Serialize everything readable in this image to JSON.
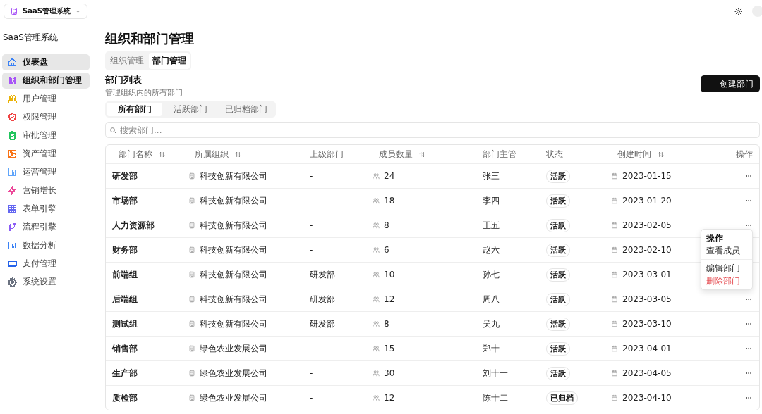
{
  "app_switcher": {
    "label": "SaaS管理系统"
  },
  "sidebar": {
    "title": "SaaS管理系统",
    "items": [
      {
        "label": "仪表盘",
        "selected": true,
        "color": "#3b82f6"
      },
      {
        "label": "组织和部门管理",
        "selected": true,
        "color": "#a855f7"
      },
      {
        "label": "用户管理",
        "selected": false,
        "color": "#eab308"
      },
      {
        "label": "权限管理",
        "selected": false,
        "color": "#ef4444"
      },
      {
        "label": "审批管理",
        "selected": false,
        "color": "#22c55e"
      },
      {
        "label": "资产管理",
        "selected": false,
        "color": "#f97316"
      },
      {
        "label": "运营管理",
        "selected": false,
        "color": "#60a5fa"
      },
      {
        "label": "营销增长",
        "selected": false,
        "color": "#ec4899"
      },
      {
        "label": "表单引擎",
        "selected": false,
        "color": "#6366f1"
      },
      {
        "label": "流程引擎",
        "selected": false,
        "color": "#8b5cf6"
      },
      {
        "label": "数据分析",
        "selected": false,
        "color": "#3b82f6"
      },
      {
        "label": "支付管理",
        "selected": false,
        "color": "#2563eb"
      },
      {
        "label": "系统设置",
        "selected": false,
        "color": "#6b7280"
      }
    ]
  },
  "page": {
    "title": "组织和部门管理",
    "tabs": [
      {
        "label": "组织管理",
        "selected": false
      },
      {
        "label": "部门管理",
        "selected": true
      }
    ]
  },
  "section": {
    "title": "部门列表",
    "subtitle": "管理组织内的所有部门",
    "create_button": "创建部门"
  },
  "filters": [
    {
      "label": "所有部门",
      "selected": true
    },
    {
      "label": "活跃部门",
      "selected": false
    },
    {
      "label": "已归档部门",
      "selected": false
    }
  ],
  "search": {
    "placeholder": "搜索部门..."
  },
  "table": {
    "columns": [
      {
        "label": "部门名称",
        "sortable": true
      },
      {
        "label": "所属组织",
        "sortable": true
      },
      {
        "label": "上级部门",
        "sortable": false
      },
      {
        "label": "成员数量",
        "sortable": true
      },
      {
        "label": "部门主管",
        "sortable": false
      },
      {
        "label": "状态",
        "sortable": false
      },
      {
        "label": "创建时间",
        "sortable": true
      },
      {
        "label": "操作",
        "sortable": false
      }
    ],
    "rows": [
      {
        "name": "研发部",
        "org": "科技创新有限公司",
        "parent": "-",
        "members": "24",
        "manager": "张三",
        "status": "活跃",
        "created": "2023-01-15",
        "menu_button": true
      },
      {
        "name": "市场部",
        "org": "科技创新有限公司",
        "parent": "-",
        "members": "18",
        "manager": "李四",
        "status": "活跃",
        "created": "2023-01-20",
        "menu_button": true
      },
      {
        "name": "人力资源部",
        "org": "科技创新有限公司",
        "parent": "-",
        "members": "8",
        "manager": "王五",
        "status": "活跃",
        "created": "2023-02-05",
        "menu_button": true,
        "menu": {
          "title": "操作",
          "items": [
            {
              "kind": "item",
              "label": "查看成员"
            },
            {
              "kind": "separator"
            },
            {
              "kind": "item",
              "label": "编辑部门"
            },
            {
              "kind": "danger",
              "label": "删除部门"
            }
          ]
        }
      },
      {
        "name": "财务部",
        "org": "科技创新有限公司",
        "parent": "-",
        "members": "6",
        "manager": "赵六",
        "status": "活跃",
        "created": "2023-02-10",
        "menu_button": false
      },
      {
        "name": "前端组",
        "org": "科技创新有限公司",
        "parent": "研发部",
        "members": "10",
        "manager": "孙七",
        "status": "活跃",
        "created": "2023-03-01",
        "menu_button": false
      },
      {
        "name": "后端组",
        "org": "科技创新有限公司",
        "parent": "研发部",
        "members": "12",
        "manager": "周八",
        "status": "活跃",
        "created": "2023-03-05",
        "menu_button": true
      },
      {
        "name": "测试组",
        "org": "科技创新有限公司",
        "parent": "研发部",
        "members": "8",
        "manager": "吴九",
        "status": "活跃",
        "created": "2023-03-10",
        "menu_button": true
      },
      {
        "name": "销售部",
        "org": "绿色农业发展公司",
        "parent": "-",
        "members": "15",
        "manager": "郑十",
        "status": "活跃",
        "created": "2023-04-01",
        "menu_button": true
      },
      {
        "name": "生产部",
        "org": "绿色农业发展公司",
        "parent": "-",
        "members": "30",
        "manager": "刘十一",
        "status": "活跃",
        "created": "2023-04-05",
        "menu_button": true
      },
      {
        "name": "质检部",
        "org": "绿色农业发展公司",
        "parent": "-",
        "members": "12",
        "manager": "陈十二",
        "status": "已归档",
        "created": "2023-04-10",
        "menu_button": true
      }
    ]
  }
}
